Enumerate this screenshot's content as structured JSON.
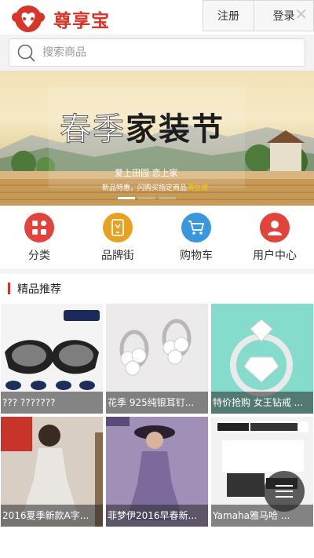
{
  "header": {
    "brand": "尊享宝",
    "register_label": "注册",
    "login_label": "登录"
  },
  "search": {
    "placeholder": "搜索商品"
  },
  "banner": {
    "title_light": "春季",
    "title_dark": "家装节",
    "subtitle": "爱上田园 恋上家",
    "promo_prefix": "新品特惠，闪购买指定商品",
    "promo_highlight": "满立减"
  },
  "nav": {
    "items": [
      {
        "label": "分类",
        "icon": "category-icon",
        "color": "#e2433a"
      },
      {
        "label": "品牌街",
        "icon": "brand-street-icon",
        "color": "#eaa11f"
      },
      {
        "label": "购物车",
        "icon": "cart-icon",
        "color": "#3a97de"
      },
      {
        "label": "用户中心",
        "icon": "user-center-icon",
        "color": "#e2433a"
      }
    ]
  },
  "recommend": {
    "title": "精品推荐",
    "products": [
      {
        "name": "??? ???????"
      },
      {
        "name": "花季 925纯银耳钉..."
      },
      {
        "name": "特价抢购 女王钻戒 ..."
      },
      {
        "name": "2016夏季新款A字..."
      },
      {
        "name": "菲梦伊2016早春新..."
      },
      {
        "name": "Yamaha雅马哈 ..."
      }
    ]
  },
  "theme": {
    "accent": "#d8342a"
  }
}
